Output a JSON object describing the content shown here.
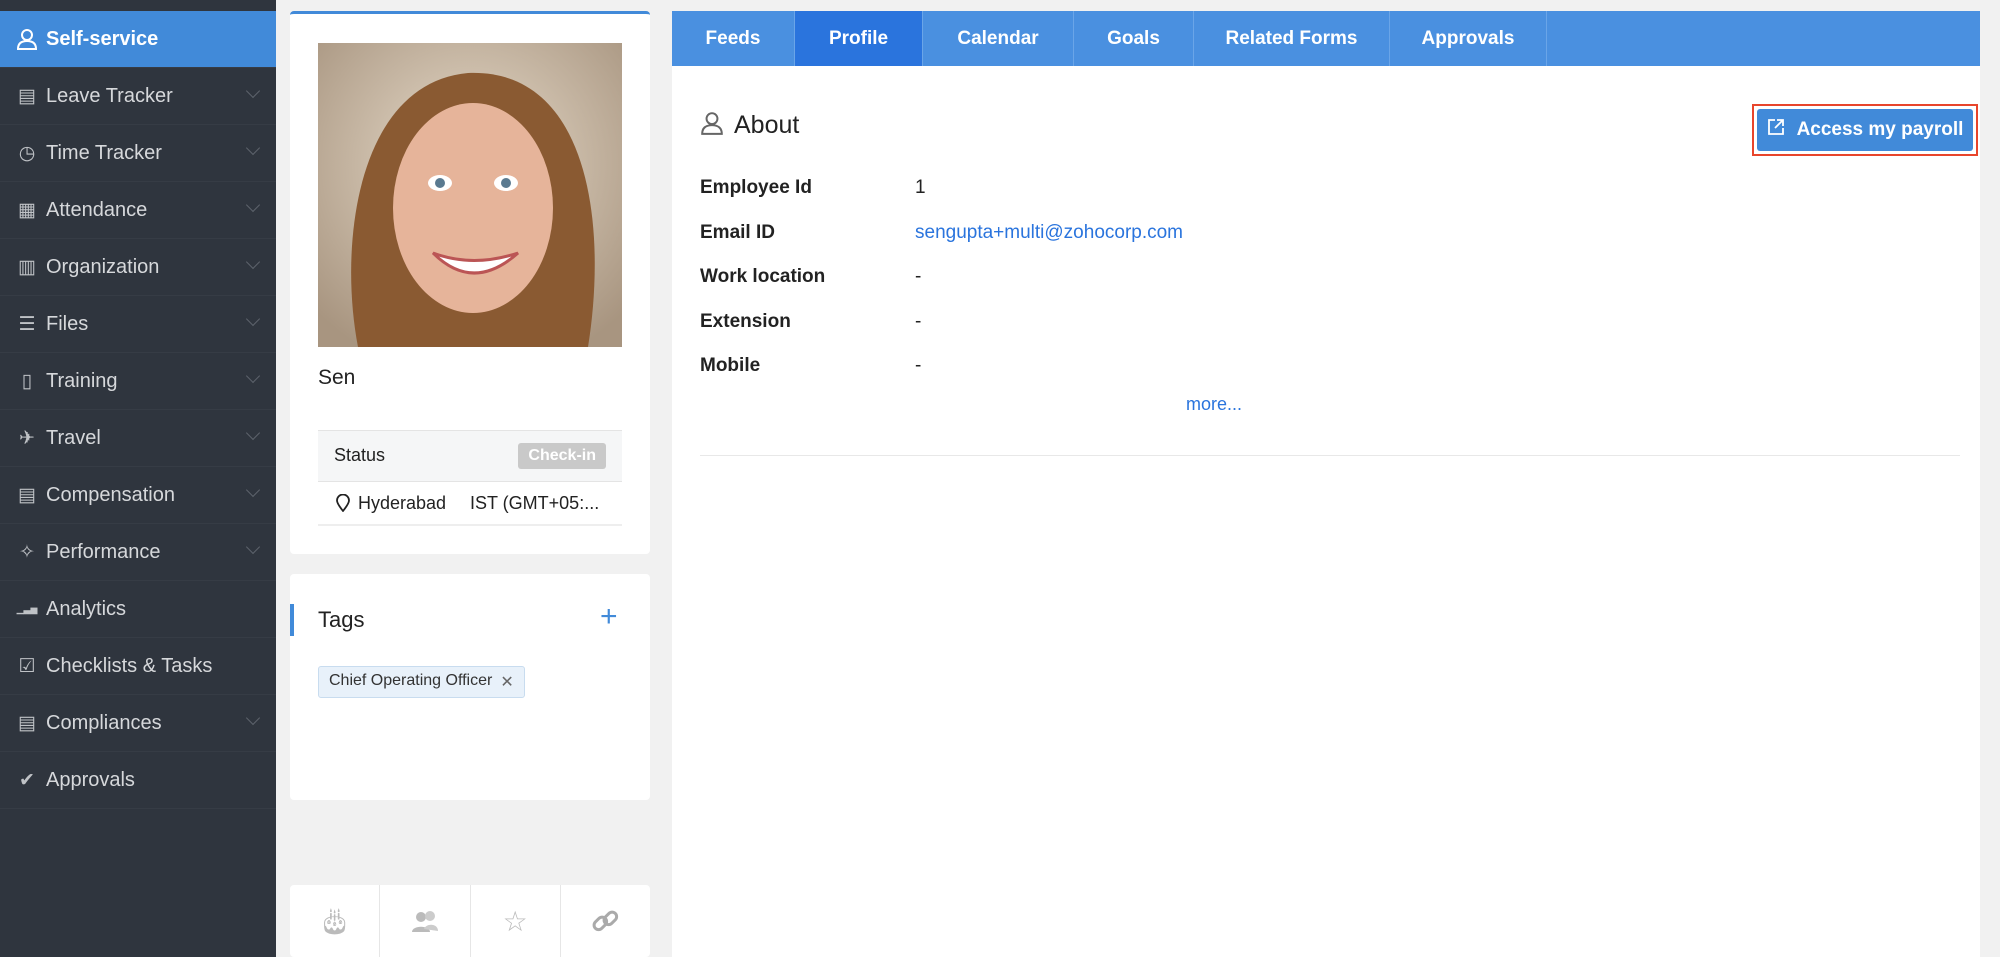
{
  "sidebar": {
    "items": [
      {
        "label": "Self-service",
        "icon": "user-icon",
        "active": true
      },
      {
        "label": "Leave Tracker",
        "icon": "leave-icon"
      },
      {
        "label": "Time Tracker",
        "icon": "clock-icon"
      },
      {
        "label": "Attendance",
        "icon": "calendar-icon"
      },
      {
        "label": "Organization",
        "icon": "building-icon"
      },
      {
        "label": "Files",
        "icon": "files-icon"
      },
      {
        "label": "Training",
        "icon": "training-icon"
      },
      {
        "label": "Travel",
        "icon": "plane-icon"
      },
      {
        "label": "Compensation",
        "icon": "compensation-icon"
      },
      {
        "label": "Performance",
        "icon": "performance-icon"
      },
      {
        "label": "Analytics",
        "icon": "analytics-icon"
      },
      {
        "label": "Checklists & Tasks",
        "icon": "checklist-icon"
      },
      {
        "label": "Compliances",
        "icon": "compliance-icon"
      },
      {
        "label": "Approvals",
        "icon": "approvals-icon"
      }
    ]
  },
  "profile": {
    "name": "Sen",
    "status_label": "Status",
    "checkin_label": "Check-in",
    "location": "Hyderabad",
    "timezone": "IST (GMT+05:..."
  },
  "tags": {
    "title": "Tags",
    "add": "+",
    "items": [
      "Chief Operating Officer"
    ]
  },
  "tabs": [
    "Feeds",
    "Profile",
    "Calendar",
    "Goals",
    "Related Forms",
    "Approvals"
  ],
  "about": {
    "title": "About",
    "payroll_button": "Access my payroll",
    "more": "more...",
    "fields": [
      {
        "label": "Employee Id",
        "value": "1"
      },
      {
        "label": "Email ID",
        "value": "sengupta+multi@zohocorp.com"
      },
      {
        "label": "Work location",
        "value": "-"
      },
      {
        "label": "Extension",
        "value": "-"
      },
      {
        "label": "Mobile",
        "value": "-"
      }
    ]
  },
  "colors": {
    "accent": "#418ad9",
    "sidebar": "#2f353e",
    "highlight": "#e8452c"
  }
}
